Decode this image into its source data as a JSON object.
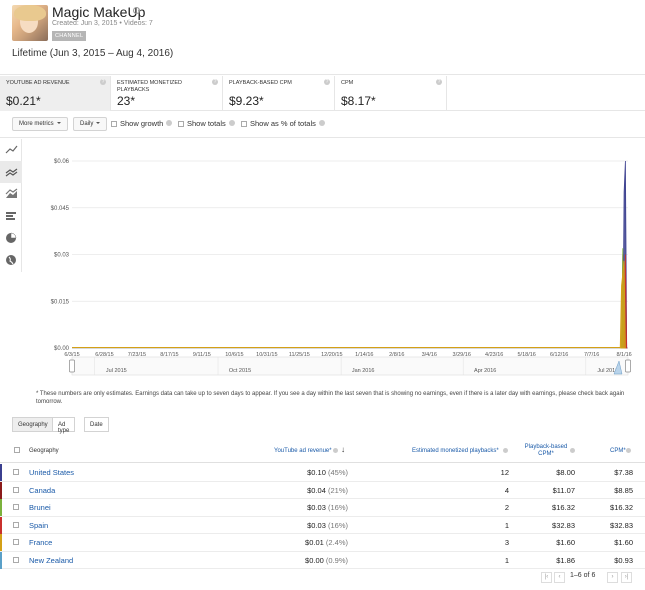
{
  "channel": {
    "title": "Magic MakeUp",
    "meta": "Created: Jun 3, 2015  •  Videos: 7",
    "badge": "CHANNEL"
  },
  "lifetime": "Lifetime (Jun 3, 2015 – Aug 4, 2016)",
  "metrics": [
    {
      "label": "YOUTUBE AD REVENUE",
      "value": "$0.21*"
    },
    {
      "label": "ESTIMATED MONETIZED PLAYBACKS",
      "value": "23*"
    },
    {
      "label": "PLAYBACK-BASED CPM",
      "value": "$9.23*"
    },
    {
      "label": "CPM",
      "value": "$8.17*"
    }
  ],
  "controls": {
    "more_metrics": "More metrics",
    "interval": "Daily",
    "show_growth": "Show growth",
    "show_totals": "Show totals",
    "show_percent": "Show as % of totals"
  },
  "side_icons": [
    "line-chart-icon",
    "multi-line-chart-icon",
    "stacked-area-icon",
    "bar-chart-icon",
    "pie-chart-icon",
    "globe-map-icon"
  ],
  "chart_data": {
    "type": "line",
    "y_ticks": [
      "$0.00",
      "$0.015",
      "$0.03",
      "$0.045",
      "$0.06"
    ],
    "ylim": [
      0,
      0.06
    ],
    "x_ticks": [
      "6/3/15",
      "6/28/15",
      "7/23/15",
      "8/17/15",
      "9/11/15",
      "10/6/15",
      "10/31/15",
      "11/25/15",
      "12/20/15",
      "1/14/16",
      "2/8/16",
      "3/4/16",
      "3/29/16",
      "4/23/16",
      "5/18/16",
      "6/12/16",
      "7/7/16",
      "8/1/16"
    ],
    "timeline_labels": [
      "Jul 2015",
      "Oct 2015",
      "Jan 2016",
      "Apr 2016",
      "Jul 2016"
    ],
    "series": [
      {
        "name": "United States",
        "color": "#3b3f8f",
        "points": [
          [
            "7/31/16",
            0.0
          ],
          [
            "8/1/16",
            0.05
          ],
          [
            "8/2/16",
            0.06
          ],
          [
            "8/3/16",
            0.0
          ]
        ]
      },
      {
        "name": "Canada",
        "color": "#8b1a1a",
        "points": [
          [
            "7/30/16",
            0.0
          ],
          [
            "7/31/16",
            0.03
          ],
          [
            "8/1/16",
            0.0
          ]
        ]
      },
      {
        "name": "Brunei",
        "color": "#7bb13c",
        "points": [
          [
            "7/30/16",
            0.0
          ],
          [
            "7/31/16",
            0.032
          ],
          [
            "8/1/16",
            0.0
          ]
        ]
      },
      {
        "name": "Spain",
        "color": "#c9302c",
        "points": [
          [
            "8/1/16",
            0.0
          ],
          [
            "8/2/16",
            0.03
          ],
          [
            "8/3/16",
            0.0
          ]
        ]
      },
      {
        "name": "France",
        "color": "#d4a017",
        "points": [
          [
            "7/29/16",
            0.0
          ],
          [
            "7/30/16",
            0.02
          ],
          [
            "8/1/16",
            0.028
          ],
          [
            "8/2/16",
            0.0
          ]
        ]
      }
    ]
  },
  "footnote": "* These numbers are only estimates. Earnings data can take up to seven days to appear. If you see a day within the last seven that is showing no earnings, even if there is a later day with earnings, please check back again tomorrow.",
  "table_tabs": [
    "Geography",
    "Ad type",
    "Date"
  ],
  "table": {
    "headers": {
      "geo": "Geography",
      "revenue": "YouTube ad revenue*",
      "playbacks": "Estimated monetized playbacks*",
      "pb_cpm": "Playback-based CPM*",
      "cpm": "CPM*"
    },
    "rows": [
      {
        "geo": "United States",
        "revenue": "$0.10",
        "pct": "(45%)",
        "playbacks": "12",
        "pb_cpm": "$8.00",
        "cpm": "$7.38",
        "color": "#3b3f8f"
      },
      {
        "geo": "Canada",
        "revenue": "$0.04",
        "pct": "(21%)",
        "playbacks": "4",
        "pb_cpm": "$11.07",
        "cpm": "$8.85",
        "color": "#8b1a1a"
      },
      {
        "geo": "Brunei",
        "revenue": "$0.03",
        "pct": "(16%)",
        "playbacks": "2",
        "pb_cpm": "$16.32",
        "cpm": "$16.32",
        "color": "#7bb13c"
      },
      {
        "geo": "Spain",
        "revenue": "$0.03",
        "pct": "(16%)",
        "playbacks": "1",
        "pb_cpm": "$32.83",
        "cpm": "$32.83",
        "color": "#c9302c"
      },
      {
        "geo": "France",
        "revenue": "$0.01",
        "pct": "(2.4%)",
        "playbacks": "3",
        "pb_cpm": "$1.60",
        "cpm": "$1.60",
        "color": "#d4a017"
      },
      {
        "geo": "New Zealand",
        "revenue": "$0.00",
        "pct": "(0.9%)",
        "playbacks": "1",
        "pb_cpm": "$1.86",
        "cpm": "$0.93",
        "color": "#5aa0c8"
      }
    ]
  },
  "pager": {
    "range": "1–6",
    "of": "of",
    "total": "6"
  }
}
